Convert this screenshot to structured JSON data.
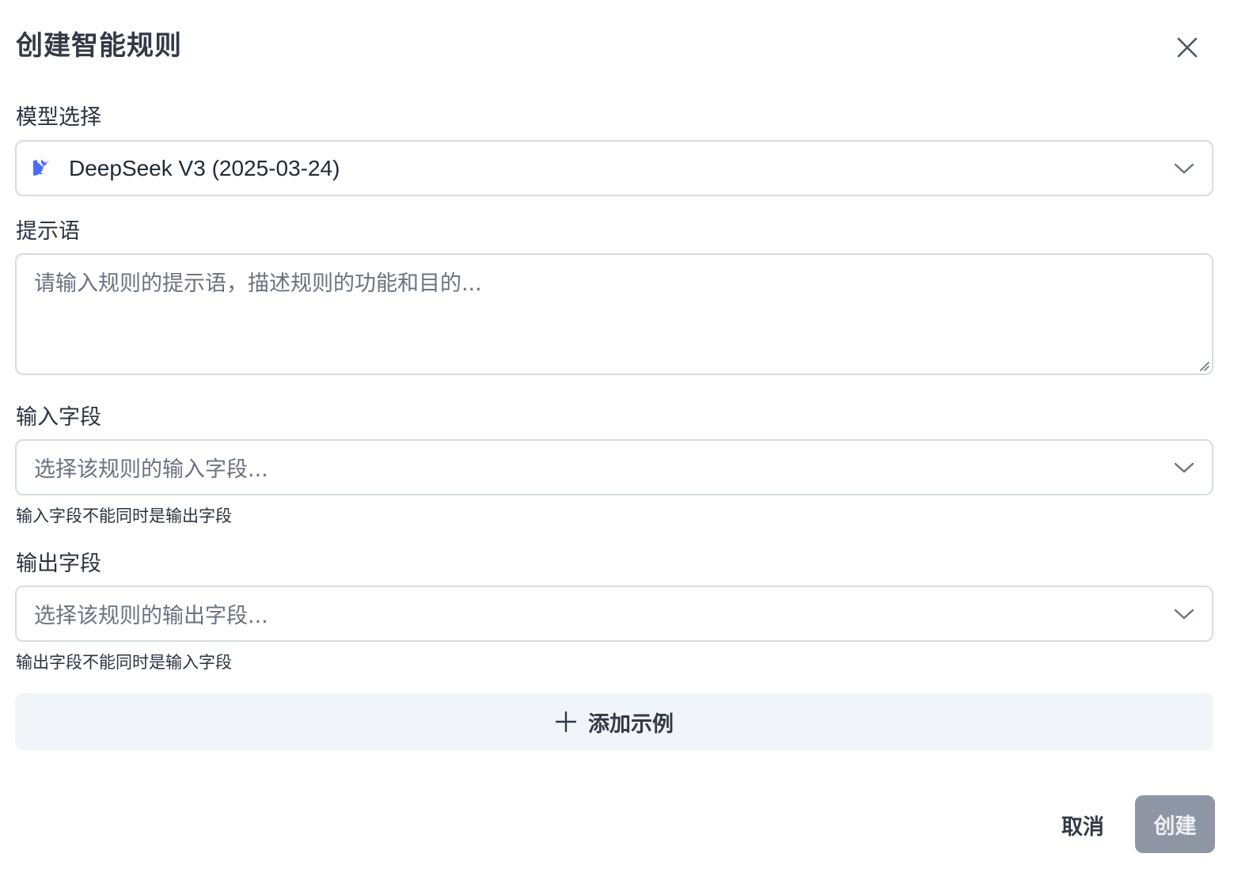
{
  "dialog": {
    "title": "创建智能规则",
    "close_icon": "close-icon"
  },
  "model": {
    "label": "模型选择",
    "value": "DeepSeek V3 (2025-03-24)",
    "icon": "deepseek-whale-icon",
    "icon_color": "#4d6bfe"
  },
  "prompt": {
    "label": "提示语",
    "placeholder": "请输入规则的提示语，描述规则的功能和目的..."
  },
  "input_fields": {
    "label": "输入字段",
    "placeholder": "选择该规则的输入字段...",
    "helper": "输入字段不能同时是输出字段"
  },
  "output_fields": {
    "label": "输出字段",
    "placeholder": "选择该规则的输出字段...",
    "helper": "输出字段不能同时是输入字段"
  },
  "actions": {
    "add_example": "添加示例",
    "cancel": "取消",
    "create": "创建"
  },
  "colors": {
    "create_button_disabled": "#8e96a6",
    "add_example_bg": "#f1f4f8",
    "border": "#d7dce3"
  }
}
